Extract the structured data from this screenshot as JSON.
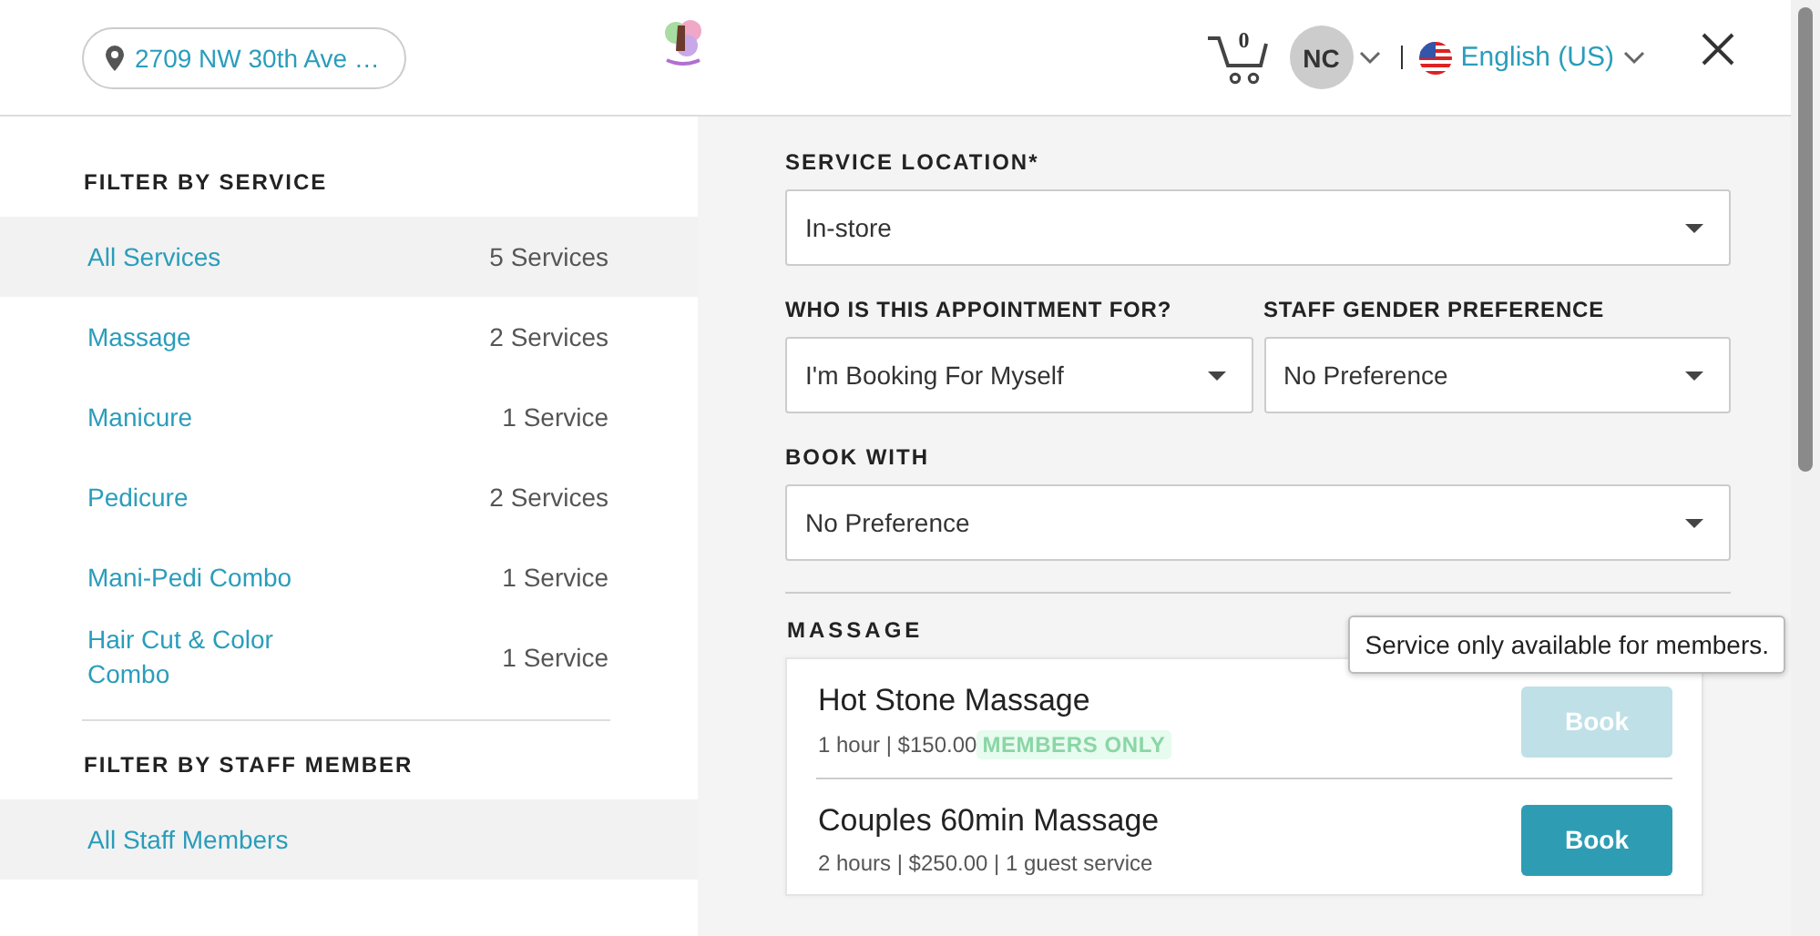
{
  "header": {
    "location": "2709 NW 30th Ave …",
    "cart_count": "0",
    "user_initials": "NC",
    "language": "English (US)"
  },
  "service_filter": {
    "title": "FILTER BY SERVICE",
    "items": [
      {
        "label": "All Services",
        "count": "5 Services",
        "selected": true
      },
      {
        "label": "Massage",
        "count": "2 Services",
        "selected": false
      },
      {
        "label": "Manicure",
        "count": "1 Service",
        "selected": false
      },
      {
        "label": "Pedicure",
        "count": "2 Services",
        "selected": false
      },
      {
        "label": "Mani-Pedi Combo",
        "count": "1 Service",
        "selected": false
      },
      {
        "label": "Hair Cut & Color Combo",
        "count": "1 Service",
        "selected": false
      }
    ]
  },
  "staff_filter": {
    "title": "FILTER BY STAFF MEMBER",
    "items": [
      {
        "label": "All Staff Members",
        "selected": true
      }
    ]
  },
  "form": {
    "service_location": {
      "label": "SERVICE LOCATION*",
      "value": "In-store"
    },
    "appointment_for": {
      "label": "WHO IS THIS APPOINTMENT FOR?",
      "value": "I'm Booking For Myself"
    },
    "staff_gender": {
      "label": "STAFF GENDER PREFERENCE",
      "value": "No Preference"
    },
    "book_with": {
      "label": "BOOK WITH",
      "value": "No Preference"
    }
  },
  "category": {
    "title": "MASSAGE",
    "services": [
      {
        "name": "Hot Stone Massage",
        "details": "1 hour | $150.00",
        "badge": "MEMBERS ONLY",
        "button": "Book",
        "disabled": true,
        "tooltip": "Service only available for members."
      },
      {
        "name": "Couples 60min Massage",
        "details": "2 hours | $250.00 | 1 guest service",
        "button": "Book",
        "disabled": false
      }
    ]
  }
}
